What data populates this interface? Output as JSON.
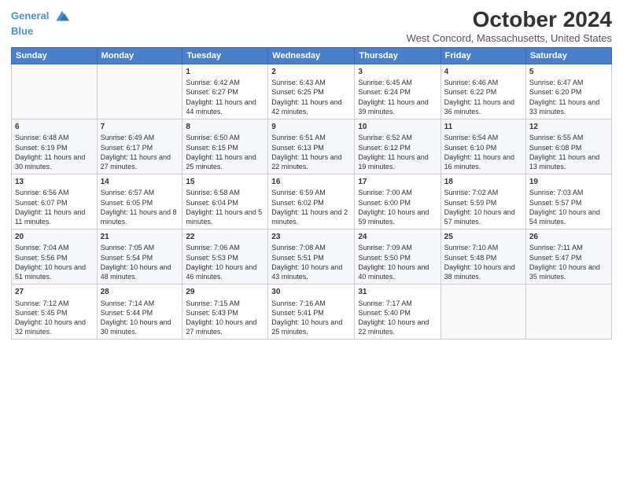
{
  "header": {
    "logo_line1": "General",
    "logo_line2": "Blue",
    "month": "October 2024",
    "location": "West Concord, Massachusetts, United States"
  },
  "weekdays": [
    "Sunday",
    "Monday",
    "Tuesday",
    "Wednesday",
    "Thursday",
    "Friday",
    "Saturday"
  ],
  "weeks": [
    [
      {
        "day": "",
        "data": ""
      },
      {
        "day": "",
        "data": ""
      },
      {
        "day": "1",
        "data": "Sunrise: 6:42 AM\nSunset: 6:27 PM\nDaylight: 11 hours and 44 minutes."
      },
      {
        "day": "2",
        "data": "Sunrise: 6:43 AM\nSunset: 6:25 PM\nDaylight: 11 hours and 42 minutes."
      },
      {
        "day": "3",
        "data": "Sunrise: 6:45 AM\nSunset: 6:24 PM\nDaylight: 11 hours and 39 minutes."
      },
      {
        "day": "4",
        "data": "Sunrise: 6:46 AM\nSunset: 6:22 PM\nDaylight: 11 hours and 36 minutes."
      },
      {
        "day": "5",
        "data": "Sunrise: 6:47 AM\nSunset: 6:20 PM\nDaylight: 11 hours and 33 minutes."
      }
    ],
    [
      {
        "day": "6",
        "data": "Sunrise: 6:48 AM\nSunset: 6:19 PM\nDaylight: 11 hours and 30 minutes."
      },
      {
        "day": "7",
        "data": "Sunrise: 6:49 AM\nSunset: 6:17 PM\nDaylight: 11 hours and 27 minutes."
      },
      {
        "day": "8",
        "data": "Sunrise: 6:50 AM\nSunset: 6:15 PM\nDaylight: 11 hours and 25 minutes."
      },
      {
        "day": "9",
        "data": "Sunrise: 6:51 AM\nSunset: 6:13 PM\nDaylight: 11 hours and 22 minutes."
      },
      {
        "day": "10",
        "data": "Sunrise: 6:52 AM\nSunset: 6:12 PM\nDaylight: 11 hours and 19 minutes."
      },
      {
        "day": "11",
        "data": "Sunrise: 6:54 AM\nSunset: 6:10 PM\nDaylight: 11 hours and 16 minutes."
      },
      {
        "day": "12",
        "data": "Sunrise: 6:55 AM\nSunset: 6:08 PM\nDaylight: 11 hours and 13 minutes."
      }
    ],
    [
      {
        "day": "13",
        "data": "Sunrise: 6:56 AM\nSunset: 6:07 PM\nDaylight: 11 hours and 11 minutes."
      },
      {
        "day": "14",
        "data": "Sunrise: 6:57 AM\nSunset: 6:05 PM\nDaylight: 11 hours and 8 minutes."
      },
      {
        "day": "15",
        "data": "Sunrise: 6:58 AM\nSunset: 6:04 PM\nDaylight: 11 hours and 5 minutes."
      },
      {
        "day": "16",
        "data": "Sunrise: 6:59 AM\nSunset: 6:02 PM\nDaylight: 11 hours and 2 minutes."
      },
      {
        "day": "17",
        "data": "Sunrise: 7:00 AM\nSunset: 6:00 PM\nDaylight: 10 hours and 59 minutes."
      },
      {
        "day": "18",
        "data": "Sunrise: 7:02 AM\nSunset: 5:59 PM\nDaylight: 10 hours and 57 minutes."
      },
      {
        "day": "19",
        "data": "Sunrise: 7:03 AM\nSunset: 5:57 PM\nDaylight: 10 hours and 54 minutes."
      }
    ],
    [
      {
        "day": "20",
        "data": "Sunrise: 7:04 AM\nSunset: 5:56 PM\nDaylight: 10 hours and 51 minutes."
      },
      {
        "day": "21",
        "data": "Sunrise: 7:05 AM\nSunset: 5:54 PM\nDaylight: 10 hours and 48 minutes."
      },
      {
        "day": "22",
        "data": "Sunrise: 7:06 AM\nSunset: 5:53 PM\nDaylight: 10 hours and 46 minutes."
      },
      {
        "day": "23",
        "data": "Sunrise: 7:08 AM\nSunset: 5:51 PM\nDaylight: 10 hours and 43 minutes."
      },
      {
        "day": "24",
        "data": "Sunrise: 7:09 AM\nSunset: 5:50 PM\nDaylight: 10 hours and 40 minutes."
      },
      {
        "day": "25",
        "data": "Sunrise: 7:10 AM\nSunset: 5:48 PM\nDaylight: 10 hours and 38 minutes."
      },
      {
        "day": "26",
        "data": "Sunrise: 7:11 AM\nSunset: 5:47 PM\nDaylight: 10 hours and 35 minutes."
      }
    ],
    [
      {
        "day": "27",
        "data": "Sunrise: 7:12 AM\nSunset: 5:45 PM\nDaylight: 10 hours and 32 minutes."
      },
      {
        "day": "28",
        "data": "Sunrise: 7:14 AM\nSunset: 5:44 PM\nDaylight: 10 hours and 30 minutes."
      },
      {
        "day": "29",
        "data": "Sunrise: 7:15 AM\nSunset: 5:43 PM\nDaylight: 10 hours and 27 minutes."
      },
      {
        "day": "30",
        "data": "Sunrise: 7:16 AM\nSunset: 5:41 PM\nDaylight: 10 hours and 25 minutes."
      },
      {
        "day": "31",
        "data": "Sunrise: 7:17 AM\nSunset: 5:40 PM\nDaylight: 10 hours and 22 minutes."
      },
      {
        "day": "",
        "data": ""
      },
      {
        "day": "",
        "data": ""
      }
    ]
  ]
}
